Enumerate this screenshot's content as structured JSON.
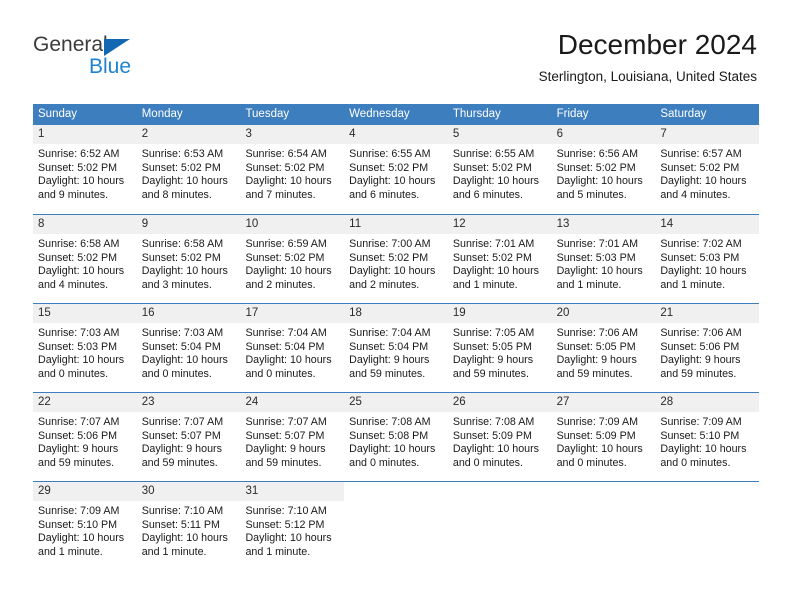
{
  "brand": {
    "name_part1": "General",
    "name_part2": "Blue",
    "accent_color": "#2083d0",
    "triangle_color": "#1267b2"
  },
  "header": {
    "title": "December 2024",
    "subtitle": "Sterlington, Louisiana, United States"
  },
  "calendar": {
    "header_bg": "#3d7ebf",
    "daynum_bg": "#f0f0f0",
    "weekdays": [
      "Sunday",
      "Monday",
      "Tuesday",
      "Wednesday",
      "Thursday",
      "Friday",
      "Saturday"
    ],
    "weeks": [
      [
        {
          "day": "1",
          "lines": [
            "Sunrise: 6:52 AM",
            "Sunset: 5:02 PM",
            "Daylight: 10 hours",
            "and 9 minutes."
          ]
        },
        {
          "day": "2",
          "lines": [
            "Sunrise: 6:53 AM",
            "Sunset: 5:02 PM",
            "Daylight: 10 hours",
            "and 8 minutes."
          ]
        },
        {
          "day": "3",
          "lines": [
            "Sunrise: 6:54 AM",
            "Sunset: 5:02 PM",
            "Daylight: 10 hours",
            "and 7 minutes."
          ]
        },
        {
          "day": "4",
          "lines": [
            "Sunrise: 6:55 AM",
            "Sunset: 5:02 PM",
            "Daylight: 10 hours",
            "and 6 minutes."
          ]
        },
        {
          "day": "5",
          "lines": [
            "Sunrise: 6:55 AM",
            "Sunset: 5:02 PM",
            "Daylight: 10 hours",
            "and 6 minutes."
          ]
        },
        {
          "day": "6",
          "lines": [
            "Sunrise: 6:56 AM",
            "Sunset: 5:02 PM",
            "Daylight: 10 hours",
            "and 5 minutes."
          ]
        },
        {
          "day": "7",
          "lines": [
            "Sunrise: 6:57 AM",
            "Sunset: 5:02 PM",
            "Daylight: 10 hours",
            "and 4 minutes."
          ]
        }
      ],
      [
        {
          "day": "8",
          "lines": [
            "Sunrise: 6:58 AM",
            "Sunset: 5:02 PM",
            "Daylight: 10 hours",
            "and 4 minutes."
          ]
        },
        {
          "day": "9",
          "lines": [
            "Sunrise: 6:58 AM",
            "Sunset: 5:02 PM",
            "Daylight: 10 hours",
            "and 3 minutes."
          ]
        },
        {
          "day": "10",
          "lines": [
            "Sunrise: 6:59 AM",
            "Sunset: 5:02 PM",
            "Daylight: 10 hours",
            "and 2 minutes."
          ]
        },
        {
          "day": "11",
          "lines": [
            "Sunrise: 7:00 AM",
            "Sunset: 5:02 PM",
            "Daylight: 10 hours",
            "and 2 minutes."
          ]
        },
        {
          "day": "12",
          "lines": [
            "Sunrise: 7:01 AM",
            "Sunset: 5:02 PM",
            "Daylight: 10 hours",
            "and 1 minute."
          ]
        },
        {
          "day": "13",
          "lines": [
            "Sunrise: 7:01 AM",
            "Sunset: 5:03 PM",
            "Daylight: 10 hours",
            "and 1 minute."
          ]
        },
        {
          "day": "14",
          "lines": [
            "Sunrise: 7:02 AM",
            "Sunset: 5:03 PM",
            "Daylight: 10 hours",
            "and 1 minute."
          ]
        }
      ],
      [
        {
          "day": "15",
          "lines": [
            "Sunrise: 7:03 AM",
            "Sunset: 5:03 PM",
            "Daylight: 10 hours",
            "and 0 minutes."
          ]
        },
        {
          "day": "16",
          "lines": [
            "Sunrise: 7:03 AM",
            "Sunset: 5:04 PM",
            "Daylight: 10 hours",
            "and 0 minutes."
          ]
        },
        {
          "day": "17",
          "lines": [
            "Sunrise: 7:04 AM",
            "Sunset: 5:04 PM",
            "Daylight: 10 hours",
            "and 0 minutes."
          ]
        },
        {
          "day": "18",
          "lines": [
            "Sunrise: 7:04 AM",
            "Sunset: 5:04 PM",
            "Daylight: 9 hours",
            "and 59 minutes."
          ]
        },
        {
          "day": "19",
          "lines": [
            "Sunrise: 7:05 AM",
            "Sunset: 5:05 PM",
            "Daylight: 9 hours",
            "and 59 minutes."
          ]
        },
        {
          "day": "20",
          "lines": [
            "Sunrise: 7:06 AM",
            "Sunset: 5:05 PM",
            "Daylight: 9 hours",
            "and 59 minutes."
          ]
        },
        {
          "day": "21",
          "lines": [
            "Sunrise: 7:06 AM",
            "Sunset: 5:06 PM",
            "Daylight: 9 hours",
            "and 59 minutes."
          ]
        }
      ],
      [
        {
          "day": "22",
          "lines": [
            "Sunrise: 7:07 AM",
            "Sunset: 5:06 PM",
            "Daylight: 9 hours",
            "and 59 minutes."
          ]
        },
        {
          "day": "23",
          "lines": [
            "Sunrise: 7:07 AM",
            "Sunset: 5:07 PM",
            "Daylight: 9 hours",
            "and 59 minutes."
          ]
        },
        {
          "day": "24",
          "lines": [
            "Sunrise: 7:07 AM",
            "Sunset: 5:07 PM",
            "Daylight: 9 hours",
            "and 59 minutes."
          ]
        },
        {
          "day": "25",
          "lines": [
            "Sunrise: 7:08 AM",
            "Sunset: 5:08 PM",
            "Daylight: 10 hours",
            "and 0 minutes."
          ]
        },
        {
          "day": "26",
          "lines": [
            "Sunrise: 7:08 AM",
            "Sunset: 5:09 PM",
            "Daylight: 10 hours",
            "and 0 minutes."
          ]
        },
        {
          "day": "27",
          "lines": [
            "Sunrise: 7:09 AM",
            "Sunset: 5:09 PM",
            "Daylight: 10 hours",
            "and 0 minutes."
          ]
        },
        {
          "day": "28",
          "lines": [
            "Sunrise: 7:09 AM",
            "Sunset: 5:10 PM",
            "Daylight: 10 hours",
            "and 0 minutes."
          ]
        }
      ],
      [
        {
          "day": "29",
          "lines": [
            "Sunrise: 7:09 AM",
            "Sunset: 5:10 PM",
            "Daylight: 10 hours",
            "and 1 minute."
          ]
        },
        {
          "day": "30",
          "lines": [
            "Sunrise: 7:10 AM",
            "Sunset: 5:11 PM",
            "Daylight: 10 hours",
            "and 1 minute."
          ]
        },
        {
          "day": "31",
          "lines": [
            "Sunrise: 7:10 AM",
            "Sunset: 5:12 PM",
            "Daylight: 10 hours",
            "and 1 minute."
          ]
        },
        {
          "day": "",
          "lines": []
        },
        {
          "day": "",
          "lines": []
        },
        {
          "day": "",
          "lines": []
        },
        {
          "day": "",
          "lines": []
        }
      ]
    ]
  }
}
